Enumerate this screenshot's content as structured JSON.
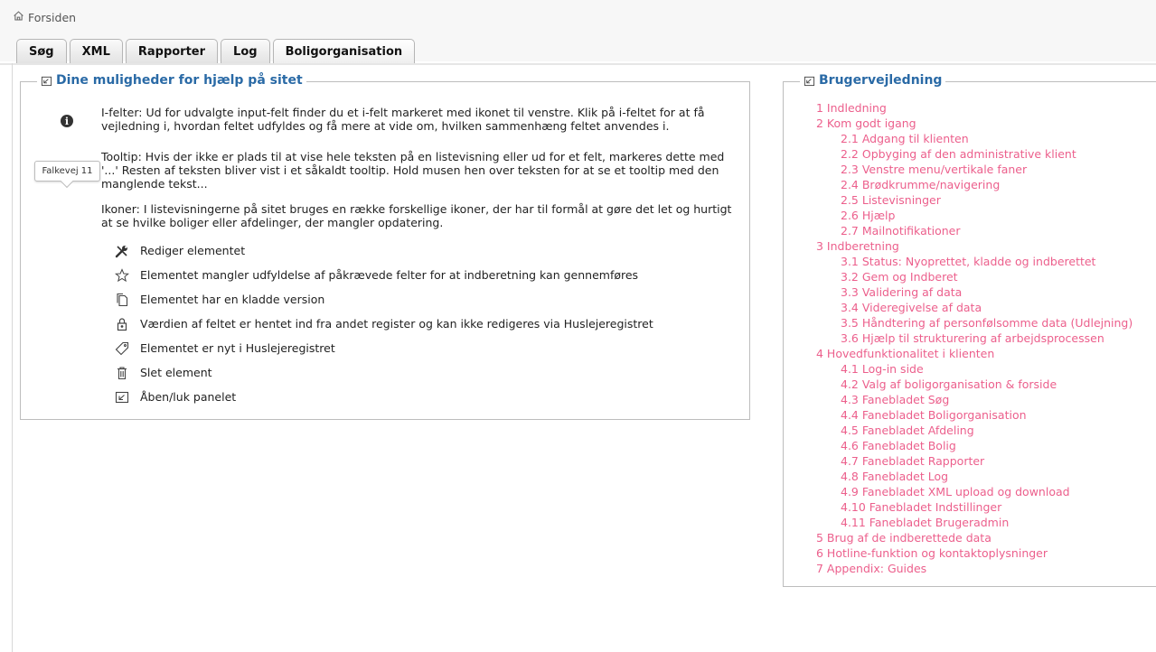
{
  "breadcrumb": {
    "home_icon": "home-icon",
    "label": "Forsiden"
  },
  "tabs": [
    {
      "label": "Søg"
    },
    {
      "label": "XML"
    },
    {
      "label": "Rapporter"
    },
    {
      "label": "Log"
    },
    {
      "label": "Boligorganisation"
    }
  ],
  "help_panel": {
    "title": "Dine muligheder for hjælp på sitet",
    "paragraphs": [
      "I-felter: Ud for udvalgte input-felt finder du et i-felt markeret med ikonet til venstre. Klik på i-feltet for at få vejledning i, hvordan feltet udfyldes og få mere at vide om, hvilken sammenhæng feltet anvendes i.",
      "Tooltip: Hvis der ikke er plads til at vise hele teksten på en listevisning eller ud for et felt, markeres dette med '...' Resten af teksten bliver vist i et såkaldt tooltip. Hold musen hen over teksten for at se et tooltip med den manglende tekst...",
      "Ikoner: I listevisningerne på sitet bruges en række forskellige ikoner, der har til formål at gøre det let og hurtigt at se hvilke boliger eller afdelinger, der mangler opdatering."
    ],
    "tooltip_example": "Falkevej 11",
    "legend": [
      {
        "icon": "wrench-icon",
        "label": "Rediger elementet"
      },
      {
        "icon": "star-icon",
        "label": "Elementet mangler udfyldelse af påkrævede felter for at indberetning kan gennemføres"
      },
      {
        "icon": "copy-icon",
        "label": "Elementet har en kladde version"
      },
      {
        "icon": "lock-icon",
        "label": "Værdien af feltet er hentet ind fra andet register og kan ikke redigeres via Huslejeregistret"
      },
      {
        "icon": "tag-icon",
        "label": "Elementet er nyt i Huslejeregistret"
      },
      {
        "icon": "trash-icon",
        "label": "Slet element"
      },
      {
        "icon": "panel-toggle-icon",
        "label": "Åben/luk panelet"
      }
    ]
  },
  "guide_panel": {
    "title": "Brugervejledning",
    "items": [
      {
        "label": "1 Indledning",
        "level": 1
      },
      {
        "label": "2 Kom godt igang",
        "level": 1
      },
      {
        "label": "2.1 Adgang til klienten",
        "level": 2
      },
      {
        "label": "2.2 Opbyging af den administrative klient",
        "level": 2
      },
      {
        "label": "2.3 Venstre menu/vertikale faner",
        "level": 2
      },
      {
        "label": "2.4 Brødkrumme/navigering",
        "level": 2
      },
      {
        "label": "2.5 Listevisninger",
        "level": 2
      },
      {
        "label": "2.6 Hjælp",
        "level": 2
      },
      {
        "label": "2.7 Mailnotifikationer",
        "level": 2
      },
      {
        "label": "3 Indberetning",
        "level": 1
      },
      {
        "label": "3.1 Status: Nyoprettet, kladde og indberettet",
        "level": 2
      },
      {
        "label": "3.2 Gem og Indberet",
        "level": 2
      },
      {
        "label": "3.3 Validering af data",
        "level": 2
      },
      {
        "label": "3.4 Videregivelse af data",
        "level": 2
      },
      {
        "label": "3.5 Håndtering af personfølsomme data (Udlejning)",
        "level": 2
      },
      {
        "label": "3.6 Hjælp til strukturering af arbejdsprocessen",
        "level": 2
      },
      {
        "label": "4 Hovedfunktionalitet i klienten",
        "level": 1
      },
      {
        "label": "4.1 Log-in side",
        "level": 2
      },
      {
        "label": "4.2 Valg af boligorganisation & forside",
        "level": 2
      },
      {
        "label": "4.3 Fanebladet Søg",
        "level": 2
      },
      {
        "label": "4.4 Fanebladet Boligorganisation",
        "level": 2
      },
      {
        "label": "4.5 Fanebladet Afdeling",
        "level": 2
      },
      {
        "label": "4.6 Fanebladet Bolig",
        "level": 2
      },
      {
        "label": "4.7 Fanebladet Rapporter",
        "level": 2
      },
      {
        "label": "4.8 Fanebladet Log",
        "level": 2
      },
      {
        "label": "4.9 Fanebladet XML upload og download",
        "level": 2
      },
      {
        "label": "4.10 Fanebladet Indstillinger",
        "level": 2
      },
      {
        "label": "4.11 Fanebladet Brugeradmin",
        "level": 2
      },
      {
        "label": "5 Brug af de indberettede data",
        "level": 1
      },
      {
        "label": "6 Hotline-funktion og kontaktoplysninger",
        "level": 1
      },
      {
        "label": "7 Appendix: Guides",
        "level": 1
      }
    ]
  },
  "colors": {
    "link": "#ec5f8c",
    "title": "#2a6aa6"
  }
}
